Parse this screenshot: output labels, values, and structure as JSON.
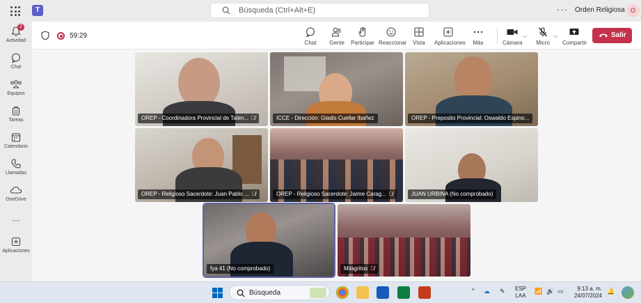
{
  "titlebar": {
    "search_placeholder": "Búsqueda (Ctrl+Alt+E)",
    "more": "···",
    "org_name": "Orden Religiosa ...",
    "avatar_initials": "O"
  },
  "rail": {
    "items": [
      {
        "label": "Actividad",
        "icon": "bell-icon",
        "badge": "2"
      },
      {
        "label": "Chat",
        "icon": "chat-icon"
      },
      {
        "label": "Equipos",
        "icon": "teams-icon"
      },
      {
        "label": "Tareas",
        "icon": "tasks-icon"
      },
      {
        "label": "Calendario",
        "icon": "calendar-icon"
      },
      {
        "label": "Llamadas",
        "icon": "phone-icon"
      },
      {
        "label": "OneDrive",
        "icon": "cloud-icon"
      },
      {
        "label": "···",
        "icon": "more-icon"
      },
      {
        "label": "Aplicaciones",
        "icon": "add-apps-icon"
      }
    ]
  },
  "meeting": {
    "timer": "59:29",
    "participant_count": "8",
    "toolbar": {
      "chat": "Chat",
      "people": "Gente",
      "raise": "Participar",
      "react": "Reaccionar",
      "view": "Vista",
      "apps": "Aplicaciones",
      "more": "Más",
      "camera": "Cámara",
      "mic": "Micro",
      "share": "Compartir",
      "leave": "Salir"
    },
    "tiles": [
      {
        "name": "OREP - Coordinadora Provincial de Talen...",
        "muted": true
      },
      {
        "name": "ICCE - Dirección: Gladis Cuellar Ibañez",
        "muted": false
      },
      {
        "name": "OREP - Preposito Provincial: Oswaldo Espino...",
        "muted": false
      },
      {
        "name": "OREP - Religioso Sacerdote: Juan Pablo ...",
        "muted": true
      },
      {
        "name": "OREP - Religioso Sacerdote: Jaime Carag...",
        "muted": true
      },
      {
        "name": "JUAN URBINA (No comprobado)",
        "muted": false
      },
      {
        "name": "fya 41 (No comprobado)",
        "muted": false
      },
      {
        "name": "Milagritos",
        "muted": true
      }
    ]
  },
  "taskbar": {
    "search": "Búsqueda",
    "lang_top": "ESP",
    "lang_bottom": "LAA",
    "time": "9:13 a. m.",
    "date": "24/07/2024"
  },
  "colors": {
    "accent": "#6264a7",
    "leave": "#c4314b",
    "badge": "#c4314b"
  }
}
